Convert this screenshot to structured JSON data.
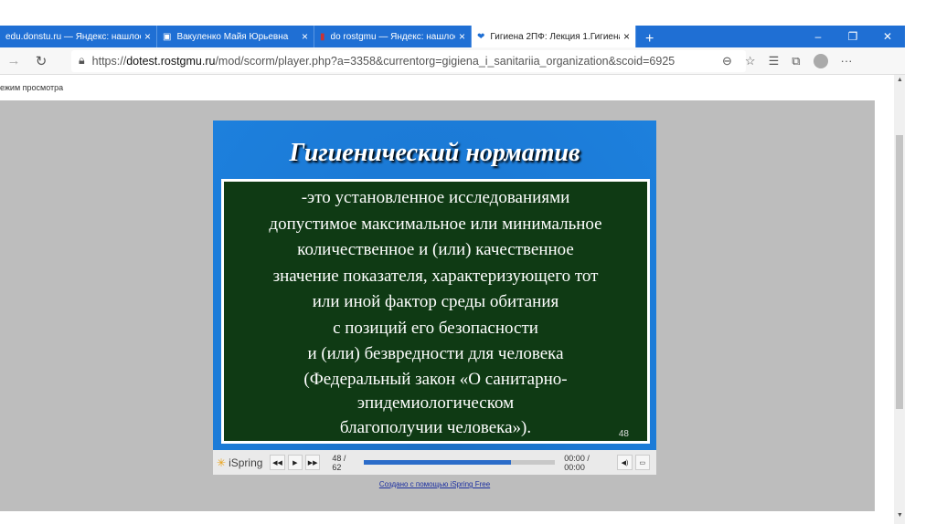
{
  "tabs": [
    {
      "title": "edu.donstu.ru — Яндекс: нашлос",
      "active": false
    },
    {
      "title": "Вакуленко Майя Юрьевна",
      "active": false
    },
    {
      "title": "do rostgmu — Яндекс: нашлось",
      "active": false
    },
    {
      "title": "Гигиена 2ПФ: Лекция 1.Гигиена",
      "active": true
    }
  ],
  "address": {
    "prefix": "https://",
    "domain": "dotest.rostgmu.ru",
    "path": "/mod/scorm/player.php?a=3358&currentorg=gigiena_i_sanitariia_organization&scoid=6925"
  },
  "mode_label": "ежим просмотра",
  "slide": {
    "title": "Гигиенический норматив",
    "lines": [
      "-это установленное исследованиями",
      "допустимое максимальное или минимальное",
      "количественное и (или) качественное",
      "значение показателя, характеризующего тот",
      "или иной фактор среды обитания",
      "с позиций его безопасности",
      "и (или) безвредности для человека",
      "(Федеральный закон «О санитарно-",
      "эпидемиологическом",
      "благополучии человека»)."
    ],
    "number": "48"
  },
  "player": {
    "brand": "iSpring",
    "slide_counter": "48 / 62",
    "progress": 0.77,
    "time": "00:00 / 00:00"
  },
  "credit": "Создано с помощью iSpring Free"
}
